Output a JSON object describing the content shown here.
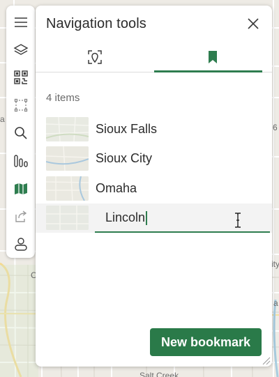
{
  "panel": {
    "title": "Navigation tools",
    "tabs": [
      {
        "icon": "locate-icon",
        "active": false
      },
      {
        "icon": "bookmark-icon",
        "active": true
      }
    ],
    "count_label": "4 items",
    "bookmarks": [
      {
        "label": "Sioux Falls"
      },
      {
        "label": "Sioux City"
      },
      {
        "label": "Omaha"
      }
    ],
    "edit_value": "Lincoln",
    "new_button_label": "New bookmark"
  },
  "toolbar": {
    "items": [
      {
        "icon": "menu-icon"
      },
      {
        "icon": "layers-icon"
      },
      {
        "icon": "qr-code-icon"
      },
      {
        "icon": "select-area-icon"
      },
      {
        "icon": "search-icon"
      },
      {
        "icon": "chart-icon"
      },
      {
        "icon": "map-icon",
        "active": true
      },
      {
        "icon": "share-icon"
      },
      {
        "icon": "account-icon"
      }
    ]
  },
  "map": {
    "labels": {
      "left_a": "a",
      "right_6": "6",
      "left_c": "C",
      "right_ity": "ity",
      "right_a": "a",
      "bottom_creek": "Salt Creek"
    }
  },
  "colors": {
    "accent": "#2e7d4f",
    "button": "#2a7a49"
  }
}
